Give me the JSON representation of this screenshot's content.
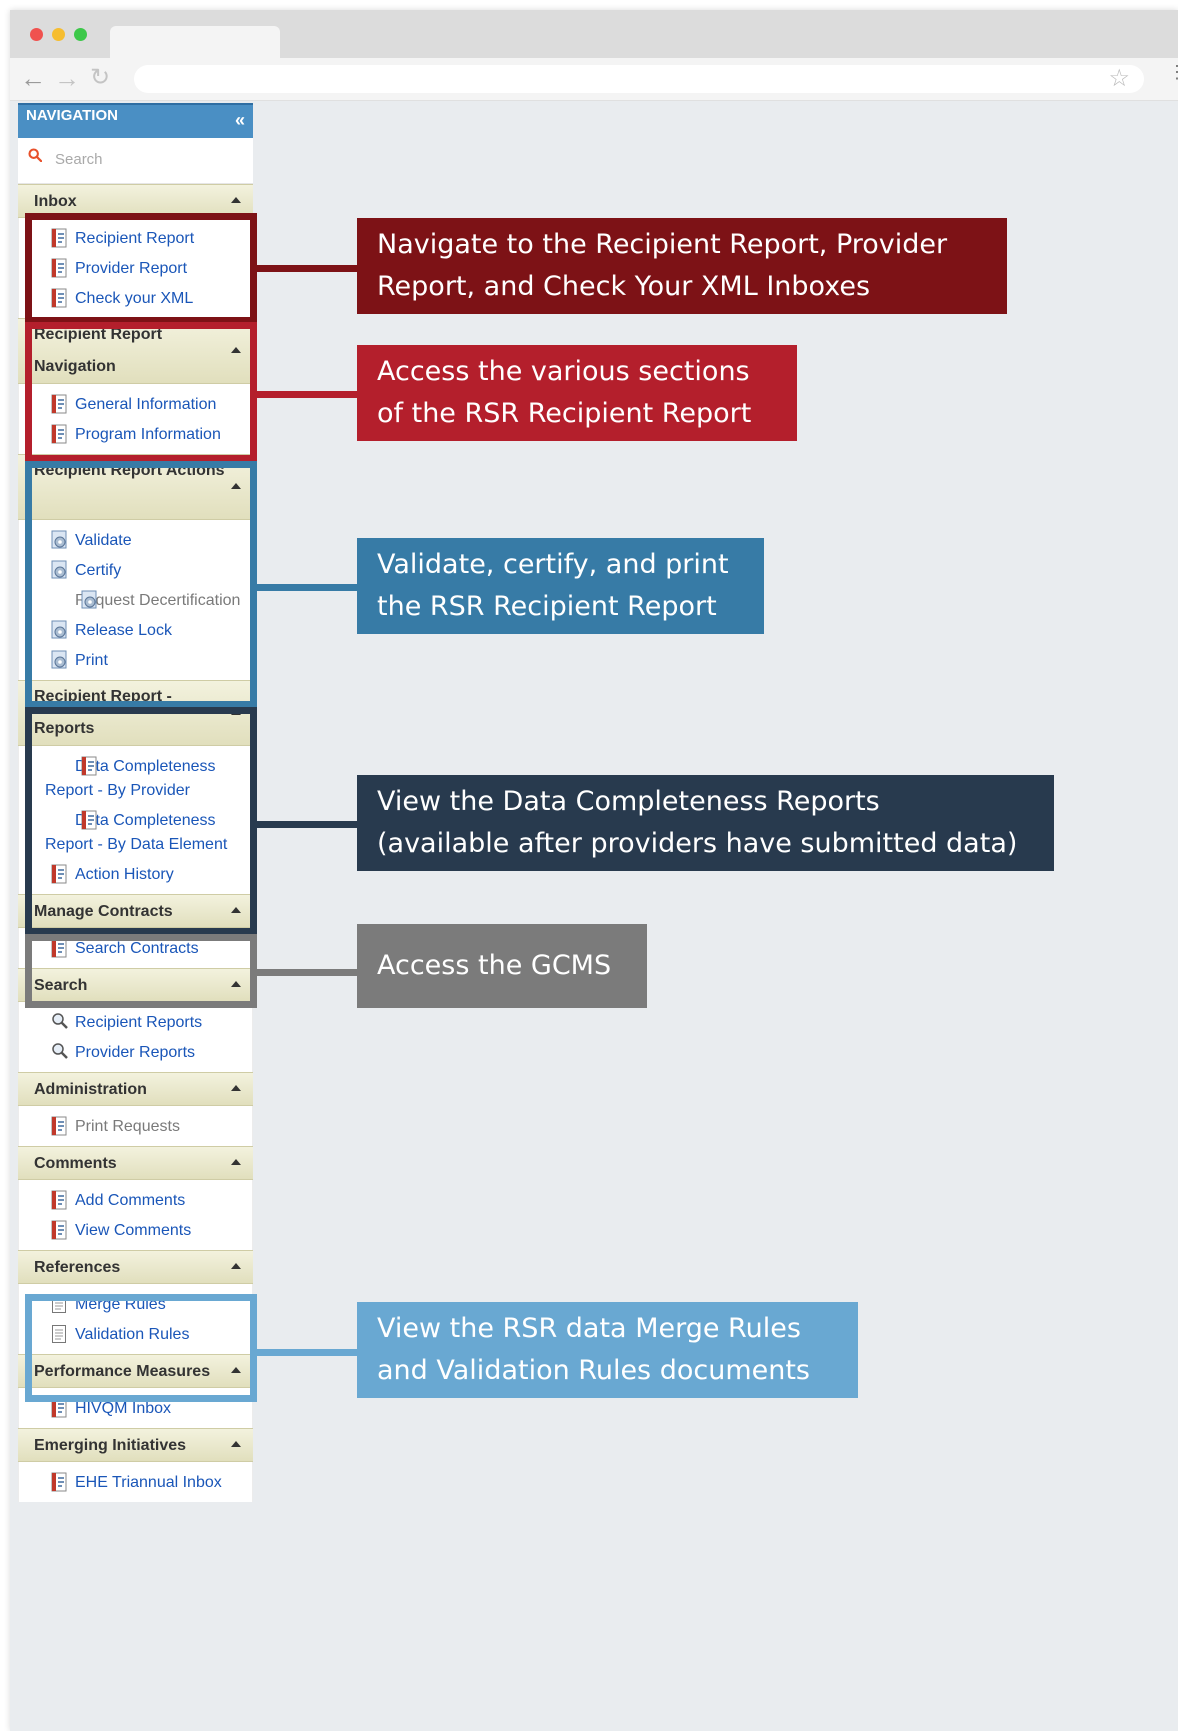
{
  "colors": {
    "dark_red": "#7d1216",
    "red": "#b41f2c",
    "blue": "#377ba6",
    "navy": "#283a4e",
    "gray": "#7b7b7b",
    "light_blue": "#69a8d2",
    "nav_header": "#4a8fc4",
    "link": "#1a56b8"
  },
  "browser": {
    "star_icon": "star-icon"
  },
  "nav": {
    "title": "NAVIGATION",
    "collapse": "«",
    "search_placeholder": "Search"
  },
  "sections": [
    {
      "title": "Inbox",
      "items": [
        {
          "label": "Recipient Report",
          "icon": "report-icon"
        },
        {
          "label": "Provider Report",
          "icon": "report-icon"
        },
        {
          "label": "Check your XML",
          "icon": "report-icon"
        }
      ]
    },
    {
      "title": "Recipient Report Navigation",
      "items": [
        {
          "label": "General Information",
          "icon": "report-icon"
        },
        {
          "label": "Program Information",
          "icon": "report-icon"
        }
      ]
    },
    {
      "title": "Recipient Report Actions",
      "items": [
        {
          "label": "Validate",
          "icon": "gear-doc-icon"
        },
        {
          "label": "Certify",
          "icon": "gear-doc-icon"
        },
        {
          "label": "Request Decertification",
          "icon": "gear-doc-icon",
          "disabled": true
        },
        {
          "label": "Release Lock",
          "icon": "gear-doc-icon"
        },
        {
          "label": "Print",
          "icon": "gear-doc-icon"
        }
      ]
    },
    {
      "title": "Recipient Report - Reports",
      "items": [
        {
          "label": "Data Completeness Report - By Provider",
          "icon": "report-icon"
        },
        {
          "label": "Data Completeness Report - By Data Element",
          "icon": "report-icon"
        },
        {
          "label": "Action History",
          "icon": "report-icon"
        }
      ]
    },
    {
      "title": "Manage Contracts",
      "items": [
        {
          "label": "Search Contracts",
          "icon": "report-icon"
        }
      ]
    },
    {
      "title": "Search",
      "items": [
        {
          "label": "Recipient Reports",
          "icon": "magnifier-doc-icon"
        },
        {
          "label": "Provider Reports",
          "icon": "magnifier-doc-icon"
        }
      ]
    },
    {
      "title": "Administration",
      "items": [
        {
          "label": "Print Requests",
          "icon": "report-icon",
          "disabled": true
        }
      ]
    },
    {
      "title": "Comments",
      "items": [
        {
          "label": "Add Comments",
          "icon": "report-icon"
        },
        {
          "label": "View Comments",
          "icon": "report-icon"
        }
      ]
    },
    {
      "title": "References",
      "items": [
        {
          "label": "Merge Rules",
          "icon": "document-icon"
        },
        {
          "label": "Validation Rules",
          "icon": "document-icon"
        }
      ]
    },
    {
      "title": "Performance Measures",
      "items": [
        {
          "label": "HIVQM Inbox",
          "icon": "report-icon"
        }
      ]
    },
    {
      "title": "Emerging Initiatives",
      "items": [
        {
          "label": "EHE Triannual Inbox",
          "icon": "report-icon"
        }
      ]
    }
  ],
  "callouts": [
    {
      "line1": "Navigate to the Recipient Report, Provider",
      "line2": "Report, and Check Your XML Inboxes"
    },
    {
      "line1": "Access the various sections",
      "line2": "of the RSR Recipient Report"
    },
    {
      "line1": "Validate, certify, and print",
      "line2": "the RSR Recipient Report"
    },
    {
      "line1": "View the Data Completeness Reports",
      "line2": "(available after providers have submitted data)"
    },
    {
      "line1": "Access the GCMS"
    },
    {
      "line1": "View the RSR data Merge Rules",
      "line2": "and Validation Rules documents"
    }
  ]
}
